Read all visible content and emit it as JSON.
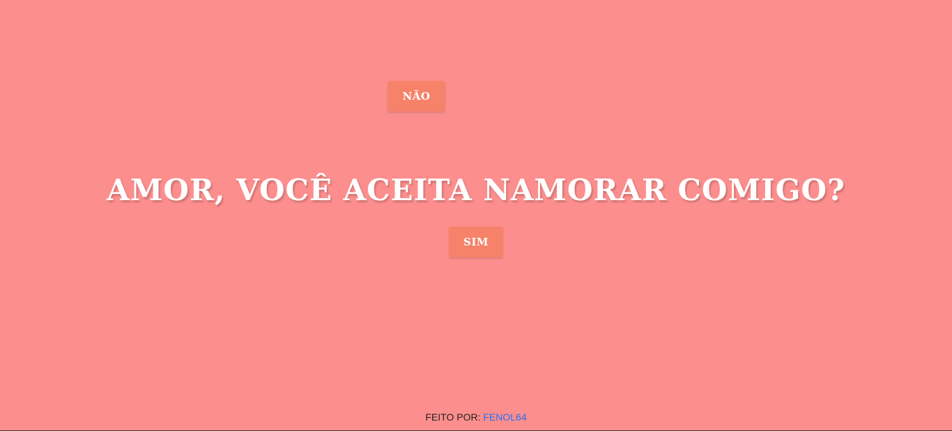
{
  "buttons": {
    "nao_label": "NÃO",
    "sim_label": "SIM"
  },
  "question": "AMOR, VOCÊ ACEITA NAMORAR COMIGO?",
  "footer": {
    "prefix": "FEITO POR:",
    "author": "FENOL64"
  },
  "colors": {
    "background": "#fc8e8d",
    "button": "#f6826a",
    "text": "#ffffff",
    "link": "#2a6ef5"
  }
}
